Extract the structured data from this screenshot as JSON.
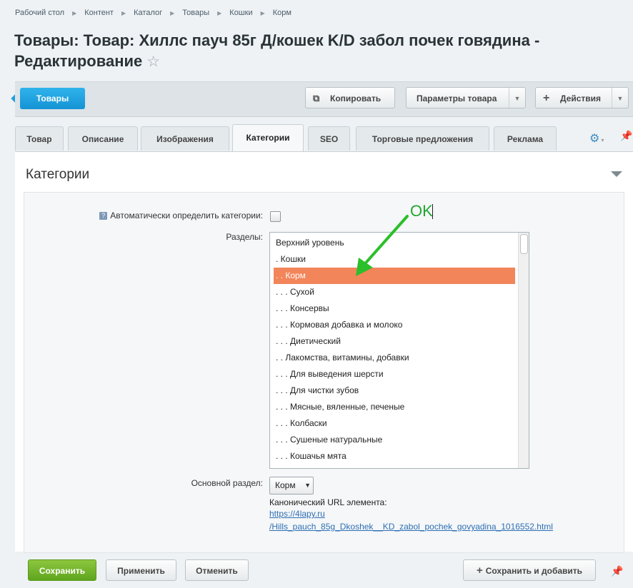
{
  "breadcrumb": [
    "Рабочий стол",
    "Контент",
    "Каталог",
    "Товары",
    "Кошки",
    "Корм"
  ],
  "page_title": "Товары: Товар: Хиллс пауч 85г Д/кошек K/D забол почек говядина - Редактирование",
  "star_icon": "☆",
  "toolbar": {
    "back_label": "Товары",
    "copy_label": "Копировать",
    "params_label": "Параметры товара",
    "actions_label": "Действия"
  },
  "tabs": [
    "Товар",
    "Описание",
    "Изображения",
    "Категории",
    "SEO",
    "Торговые предложения",
    "Реклама"
  ],
  "active_tab": "Категории",
  "section_title": "Категории",
  "form": {
    "auto_label": "Автоматически определить категории:",
    "sections_label": "Разделы:",
    "main_section_label": "Основной раздел:",
    "main_section_value": "Корм",
    "canonical_label": "Канонический URL элемента:",
    "canonical_link_1": "https://4lapy.ru",
    "canonical_link_2": "/Hills_pauch_85g_Dkoshek__KD_zabol_pochek_govyadina_1016552.html"
  },
  "sections_list": [
    "Верхний уровень",
    ". Кошки",
    ". . Корм",
    ". . . Сухой",
    ". . . Консервы",
    ". . . Кормовая добавка и молоко",
    ". . . Диетический",
    ". . Лакомства, витамины, добавки",
    ". . . Для выведения шерсти",
    ". . . Для чистки зубов",
    ". . . Мясные, вяленные, печеные",
    ". . . Колбаски",
    ". . . Сушеные натуральные",
    ". . . Кошачья мята"
  ],
  "selected_index": 2,
  "annotation": {
    "text": "OK",
    "color": "#22a630"
  },
  "footer": {
    "save_label": "Сохранить",
    "apply_label": "Применить",
    "cancel_label": "Отменить",
    "save_add_label": "Сохранить и добавить"
  },
  "colors": {
    "accent_blue": "#1fa0de",
    "selected_bg": "#f2855a",
    "save_green": "#6fb22a",
    "link": "#2f6fb4"
  }
}
